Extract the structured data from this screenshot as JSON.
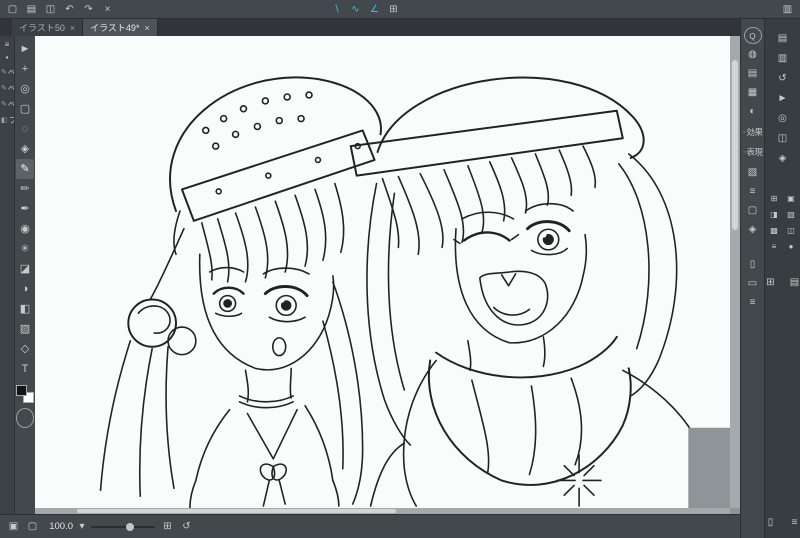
{
  "colors": {
    "accent": "#3fbdd1",
    "canvas_paper": "#fafbfb",
    "pasteboard": "#8f9498",
    "line": "#222222",
    "fg_swatch": "#141414",
    "bg_swatch": "#ffffff"
  },
  "topbar": {
    "file_icons": [
      {
        "name": "new-file-icon",
        "glyph": "▢"
      },
      {
        "name": "open-file-icon",
        "glyph": "▤"
      },
      {
        "name": "save-icon",
        "glyph": "◫"
      },
      {
        "name": "undo-icon",
        "glyph": "↶"
      },
      {
        "name": "redo-icon",
        "glyph": "↷"
      },
      {
        "name": "delete-icon",
        "glyph": "×"
      }
    ],
    "snap_icons": [
      {
        "name": "snap-to-ruler-icon",
        "glyph": "∖",
        "accent": true
      },
      {
        "name": "snap-to-special-ruler-icon",
        "glyph": "∿",
        "accent": true
      },
      {
        "name": "snap-to-grid-icon",
        "glyph": "∠",
        "accent": true
      },
      {
        "name": "grid-icon",
        "glyph": "⊞"
      }
    ],
    "right_icons": [
      {
        "name": "panel-toggle-icon",
        "glyph": "▥"
      }
    ]
  },
  "tabs": [
    {
      "label": "イラスト50",
      "close_glyph": "×"
    },
    {
      "label": "イラスト49*",
      "close_glyph": "×"
    }
  ],
  "left": {
    "subtool_header_icons": [
      {
        "name": "subtool-menu-icon",
        "glyph": "≡"
      },
      {
        "name": "subtool-group-icon",
        "glyph": "▪"
      }
    ],
    "subtools": [
      {
        "name": "subtool-item-pen-1",
        "icon": "✎",
        "label": "ペン"
      },
      {
        "name": "subtool-item-pen-2",
        "icon": "✎",
        "label": "ペン"
      },
      {
        "name": "subtool-item-pen-3",
        "icon": "✎",
        "label": "ペン"
      },
      {
        "name": "subtool-item-fill",
        "icon": "◧",
        "label": "フィ"
      }
    ],
    "tools": [
      {
        "name": "operation-tool-icon",
        "glyph": "►"
      },
      {
        "name": "move-tool-icon",
        "glyph": "+"
      },
      {
        "name": "zoom-tool-icon",
        "glyph": "◎"
      },
      {
        "name": "selection-tool-icon",
        "glyph": "▢"
      },
      {
        "name": "lasso-tool-icon",
        "glyph": "◌"
      },
      {
        "name": "eyedropper-tool-icon",
        "glyph": "◈"
      },
      {
        "name": "pen-tool-icon",
        "glyph": "✎",
        "selected": true
      },
      {
        "name": "pencil-tool-icon",
        "glyph": "✏"
      },
      {
        "name": "brush-tool-icon",
        "glyph": "✒"
      },
      {
        "name": "airbrush-tool-icon",
        "glyph": "◉"
      },
      {
        "name": "decoration-tool-icon",
        "glyph": "✳"
      },
      {
        "name": "eraser-tool-icon",
        "glyph": "◪"
      },
      {
        "name": "blend-tool-icon",
        "glyph": "◑"
      },
      {
        "name": "fill-tool-icon",
        "glyph": "◧"
      },
      {
        "name": "gradient-tool-icon",
        "glyph": "▨"
      },
      {
        "name": "figure-tool-icon",
        "glyph": "◇"
      },
      {
        "name": "text-tool-icon",
        "glyph": "T"
      }
    ]
  },
  "right": {
    "inner_top_icons": [
      {
        "name": "quick-access-icon",
        "glyph": "Q",
        "round": true
      },
      {
        "name": "color-wheel-icon",
        "glyph": "◍"
      },
      {
        "name": "color-slider-icon",
        "glyph": "▤"
      },
      {
        "name": "color-set-icon",
        "glyph": "▦"
      },
      {
        "name": "mixing-palette-icon",
        "glyph": "◐"
      }
    ],
    "panel_labels": [
      {
        "name": "layer-effect-label",
        "icon": "▫",
        "label": "効果"
      },
      {
        "name": "expression-color-label",
        "icon": "▫",
        "label": "表現"
      }
    ],
    "inner_mid_icons": [
      {
        "name": "tool-property-icon",
        "glyph": "▧"
      },
      {
        "name": "sub-tool-detail-icon",
        "glyph": "≡"
      },
      {
        "name": "navigator-icon",
        "glyph": "▢"
      },
      {
        "name": "information-icon",
        "glyph": "◈"
      }
    ],
    "inner_bottom_icons": [
      {
        "name": "layer-comp-icon",
        "glyph": "▯"
      },
      {
        "name": "timeline-icon",
        "glyph": "▭"
      },
      {
        "name": "list-icon",
        "glyph": "≡"
      }
    ],
    "outer_icons": [
      {
        "name": "material-icon",
        "glyph": "▤"
      },
      {
        "name": "material-catalog-icon",
        "glyph": "▥"
      },
      {
        "name": "history-icon",
        "glyph": "↺"
      },
      {
        "name": "auto-action-icon",
        "glyph": "►"
      },
      {
        "name": "search-icon",
        "glyph": "◎"
      },
      {
        "name": "sub-view-icon",
        "glyph": "◫"
      },
      {
        "name": "layer-property-icon",
        "glyph": "◈"
      }
    ],
    "layer_tool_icons": [
      {
        "name": "new-layer-icon",
        "glyph": "⊞"
      },
      {
        "name": "new-folder-icon",
        "glyph": "▣"
      },
      {
        "name": "clip-layer-icon",
        "glyph": "◨"
      },
      {
        "name": "lock-layer-icon",
        "glyph": "▧"
      },
      {
        "name": "mask-layer-icon",
        "glyph": "▩"
      },
      {
        "name": "duplicate-layer-icon",
        "glyph": "◫"
      },
      {
        "name": "merge-layer-icon",
        "glyph": "≡"
      },
      {
        "name": "layer-color-icon",
        "glyph": "●"
      }
    ],
    "outer_bottom_icons": [
      {
        "name": "add-layer-icon",
        "glyph": "⊞"
      },
      {
        "name": "layer-folder-icon",
        "glyph": "▤"
      }
    ],
    "foot_icons": [
      {
        "name": "delete-layer-icon",
        "glyph": "▯"
      },
      {
        "name": "palette-menu-icon",
        "glyph": "≡"
      }
    ]
  },
  "statusbar": {
    "left_icons": [
      {
        "name": "fit-to-screen-icon",
        "glyph": "▣"
      },
      {
        "name": "actual-size-icon",
        "glyph": "▢"
      }
    ],
    "zoom_value": "100.0",
    "zoom_menu_glyph": "▾",
    "mid_icons": [
      {
        "name": "zoom-grid-icon",
        "glyph": "⊞"
      },
      {
        "name": "rotate-reset-icon",
        "glyph": "↺"
      }
    ]
  }
}
